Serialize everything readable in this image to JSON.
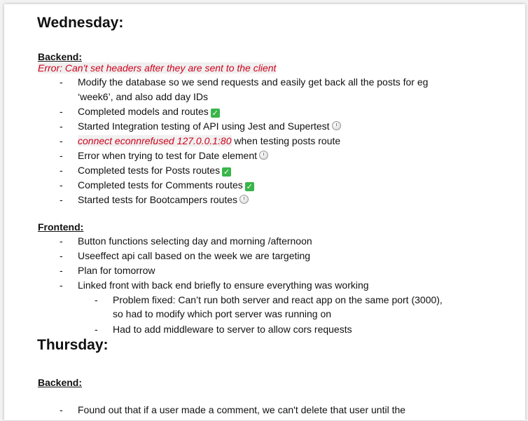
{
  "wednesday": {
    "title": "Wednesday:",
    "backend": {
      "heading": "Backend:",
      "error": "Error: Can't set headers after they are sent to the client",
      "items": [
        {
          "line1": "Modify the database so we send requests and easily get back all the posts for eg",
          "line2": "‘week6’, and also add day IDs"
        },
        {
          "text": "Completed models and routes",
          "status": "done"
        },
        {
          "text": "Started Integration testing of API using Jest and Supertest",
          "status": "pending"
        },
        {
          "error_part": "connect econnrefused 127.0.0.1:80",
          "text": " when testing posts route"
        },
        {
          "text": "Error when trying to test for Date element",
          "status": "pending"
        },
        {
          "text": "Completed tests for Posts routes",
          "status": "done"
        },
        {
          "text": "Completed tests for Comments routes",
          "status": "done"
        },
        {
          "text": "Started tests for Bootcampers routes",
          "status": "pending"
        }
      ]
    },
    "frontend": {
      "heading": "Frontend:",
      "items": [
        "Button functions selecting day and morning /afternoon",
        "Useeffect api call based on the week we are targeting",
        "Plan for tomorrow",
        "Linked front with back end briefly to ensure everything was working"
      ],
      "subitems": [
        {
          "line1": "Problem fixed: Can’t run both server and react app on the same port (3000),",
          "line2": "so had to modify which port server was running on"
        },
        {
          "line1": "Had to add middleware to server to allow cors requests"
        }
      ]
    }
  },
  "thursday": {
    "title": "Thursday:",
    "backend": {
      "heading": "Backend:",
      "items": [
        "Found out that if a user made a comment, we can't delete that user until the"
      ]
    }
  },
  "bullet": "-",
  "icons": {
    "done": "check-mark-icon",
    "pending": "clock-icon"
  },
  "colors": {
    "error": "#d0021b",
    "check": "#39b54a"
  }
}
